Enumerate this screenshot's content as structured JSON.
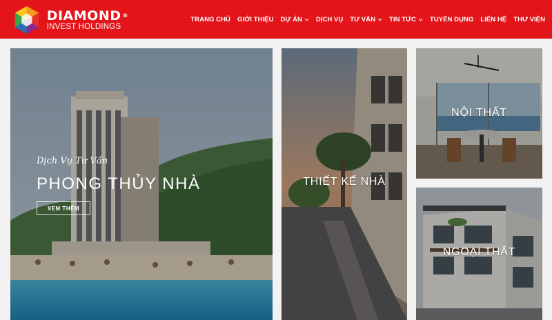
{
  "header": {
    "brand": "DIAMOND",
    "reg_mark": "®",
    "tagline": "INVEST HOLDINGS",
    "bg_color": "#e3151a"
  },
  "nav": {
    "items": [
      {
        "label": "TRANG CHỦ",
        "has_dropdown": false
      },
      {
        "label": "GIỚI THIỆU",
        "has_dropdown": false
      },
      {
        "label": "DỰ ÁN",
        "has_dropdown": true
      },
      {
        "label": "DỊCH VỤ",
        "has_dropdown": false
      },
      {
        "label": "TƯ VẤN",
        "has_dropdown": true
      },
      {
        "label": "TIN TỨC",
        "has_dropdown": true
      },
      {
        "label": "TUYỂN DỤNG",
        "has_dropdown": false
      },
      {
        "label": "LIÊN HỆ",
        "has_dropdown": false
      },
      {
        "label": "THƯ VIỆN",
        "has_dropdown": false
      }
    ]
  },
  "tiles": {
    "main": {
      "subtitle": "Dịch Vụ Tư Vấn",
      "title": "PHONG THỦY NHÀ",
      "button": "XEM THÊM"
    },
    "design": {
      "title": "THIẾT KẾ NHÀ"
    },
    "interior": {
      "title": "NỘI THẤT"
    },
    "exterior": {
      "title": "NGOẠI THẤT"
    }
  }
}
